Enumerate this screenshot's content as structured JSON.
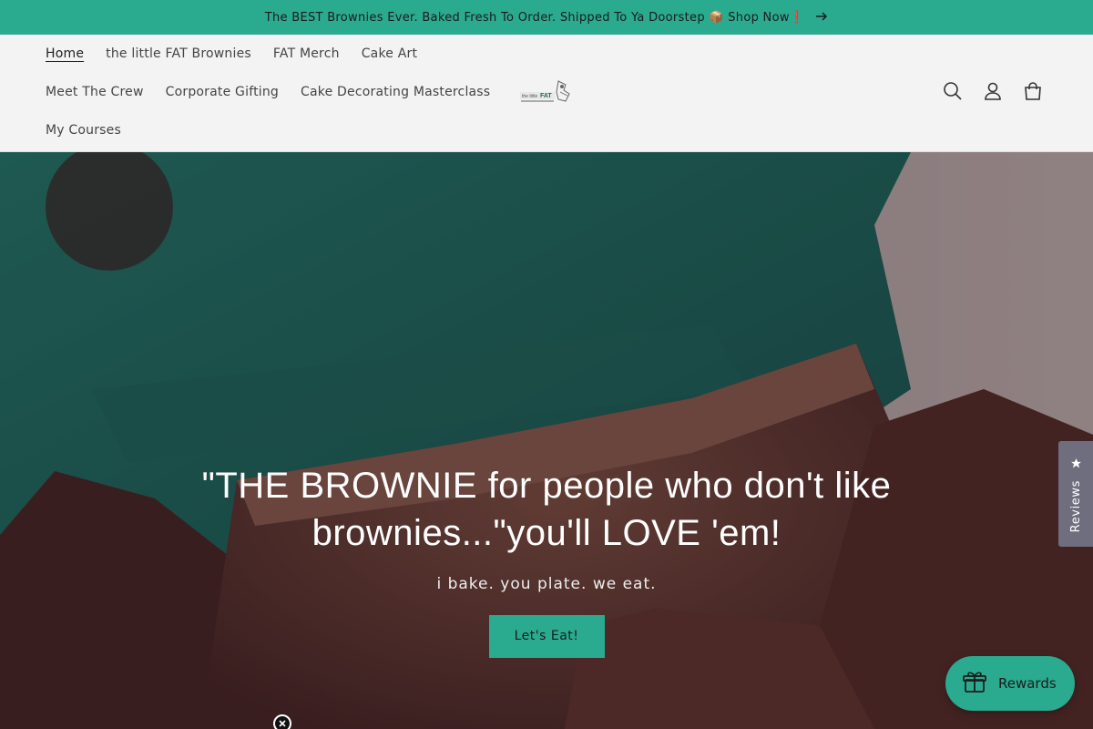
{
  "announcement": {
    "text": "The BEST Brownies Ever. Baked Fresh To Order. Shipped To Ya Doorstep 📦 Shop Now❗",
    "arrow_icon": "arrow-right-icon"
  },
  "nav": {
    "row1": [
      "Home",
      "the little FAT Brownies",
      "FAT Merch",
      "Cake Art"
    ],
    "row2": [
      "Meet The Crew",
      "Corporate Gifting",
      "Cake Decorating Masterclass"
    ],
    "row3": [
      "My Courses"
    ],
    "active": "Home"
  },
  "header_icons": [
    "search-icon",
    "account-icon",
    "cart-icon"
  ],
  "hero": {
    "title": "\"THE BROWNIE for people who don't like brownies...\"you'll LOVE 'em!",
    "subtitle": "i bake. you plate. we eat.",
    "button_label": "Let's Eat!"
  },
  "reviews_tab": {
    "label": "Reviews",
    "icon": "star-icon"
  },
  "rewards": {
    "label": "Rewards",
    "icon": "gift-icon"
  },
  "colors": {
    "accent": "#2aaa8f",
    "header_bg": "#f3f3f3",
    "reviews_tab": "#6e6e7e"
  }
}
